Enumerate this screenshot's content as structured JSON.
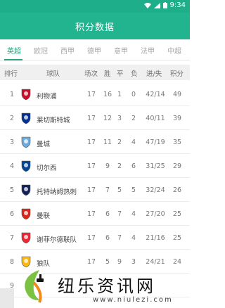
{
  "status_bar": {
    "time": "9:34",
    "bg": "#1fae8a"
  },
  "app_bar": {
    "title": "积分数据"
  },
  "tabs": [
    {
      "label": "英超",
      "active": true
    },
    {
      "label": "欧冠"
    },
    {
      "label": "西甲"
    },
    {
      "label": "德甲"
    },
    {
      "label": "意甲"
    },
    {
      "label": "法甲"
    },
    {
      "label": "中超"
    }
  ],
  "table": {
    "headers": [
      "排行",
      "球队",
      "场次",
      "胜",
      "平",
      "负",
      "进/失",
      "积分"
    ],
    "rows": [
      {
        "rank": "1",
        "team": "利物浦",
        "played": "17",
        "won": "16",
        "drawn": "1",
        "lost": "0",
        "gfga": "42/14",
        "points": "49",
        "badge": "liverpool-badge-icon",
        "color": "#c8102e"
      },
      {
        "rank": "2",
        "team": "莱切斯特城",
        "played": "17",
        "won": "12",
        "drawn": "3",
        "lost": "2",
        "gfga": "40/11",
        "points": "39",
        "badge": "leicester-badge-icon",
        "color": "#003090"
      },
      {
        "rank": "3",
        "team": "曼城",
        "played": "17",
        "won": "11",
        "drawn": "2",
        "lost": "4",
        "gfga": "47/19",
        "points": "35",
        "badge": "mancity-badge-icon",
        "color": "#6cabdd"
      },
      {
        "rank": "4",
        "team": "切尔西",
        "played": "17",
        "won": "9",
        "drawn": "2",
        "lost": "6",
        "gfga": "31/25",
        "points": "29",
        "badge": "chelsea-badge-icon",
        "color": "#034694"
      },
      {
        "rank": "5",
        "team": "托特纳姆热刺",
        "played": "17",
        "won": "7",
        "drawn": "5",
        "lost": "5",
        "gfga": "32/24",
        "points": "26",
        "badge": "tottenham-badge-icon",
        "color": "#132257"
      },
      {
        "rank": "6",
        "team": "曼联",
        "played": "17",
        "won": "6",
        "drawn": "7",
        "lost": "4",
        "gfga": "27/20",
        "points": "25",
        "badge": "manutd-badge-icon",
        "color": "#da291c"
      },
      {
        "rank": "7",
        "team": "谢菲尔德联队",
        "played": "17",
        "won": "6",
        "drawn": "7",
        "lost": "4",
        "gfga": "21/16",
        "points": "25",
        "badge": "sheffield-badge-icon",
        "color": "#ee2737"
      },
      {
        "rank": "8",
        "team": "狼队",
        "played": "17",
        "won": "5",
        "drawn": "9",
        "lost": "3",
        "gfga": "24/21",
        "points": "24",
        "badge": "wolves-badge-icon",
        "color": "#fdb913"
      },
      {
        "rank": "9",
        "team": "",
        "played": "",
        "won": "",
        "drawn": "",
        "lost": "",
        "gfga": "",
        "points": "",
        "badge": "",
        "color": "#cccccc"
      }
    ]
  },
  "watermark": {
    "text": "纽乐资讯网",
    "url": "www.niulezi.com"
  }
}
